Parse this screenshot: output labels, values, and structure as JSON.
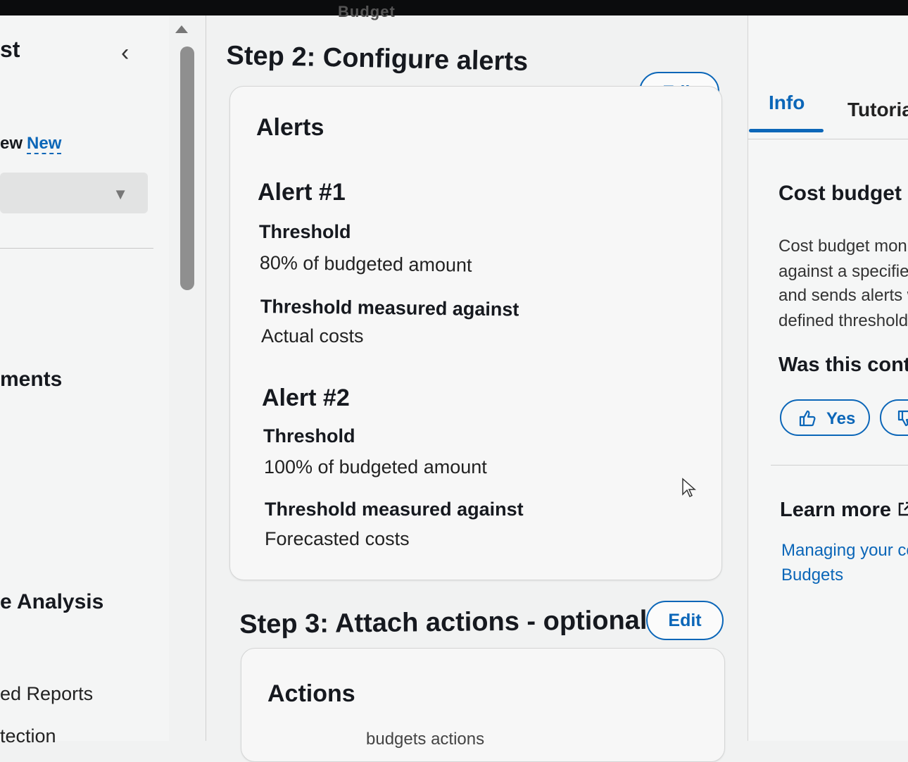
{
  "top": {
    "partial_title": "Budget"
  },
  "leftnav": {
    "title_fragment": "st",
    "new_row_prefix": "ew",
    "new_label": "New",
    "section_fragment": "ments",
    "analysis_fragment": "e Analysis",
    "reports_fragment": "ed Reports",
    "detection_fragment": "tection"
  },
  "main": {
    "step2": {
      "title": "Step 2: Configure alerts",
      "edit": "Edit",
      "card_title": "Alerts",
      "alerts": [
        {
          "title": "Alert #1",
          "threshold_label": "Threshold",
          "threshold_value": "80% of budgeted amount",
          "measured_label": "Threshold measured against",
          "measured_value": "Actual costs"
        },
        {
          "title": "Alert #2",
          "threshold_label": "Threshold",
          "threshold_value": "100% of budgeted amount",
          "measured_label": "Threshold measured against",
          "measured_value": "Forecasted costs"
        }
      ]
    },
    "step3": {
      "title": "Step 3: Attach actions - optional",
      "edit": "Edit",
      "card_title": "Actions",
      "partial_line": "budgets actions"
    }
  },
  "panel": {
    "tabs": [
      "Info",
      "Tutorial"
    ],
    "help_title": "Cost budget",
    "help_lines": [
      "Cost budget monit",
      "against a specified",
      "and sends alerts wh",
      "defined thresholds"
    ],
    "feedback_question": "Was this conte",
    "yes_label": "Yes",
    "learn_more": "Learn more",
    "links": [
      "Managing your cos",
      "Budgets"
    ]
  },
  "colors": {
    "accent": "#0b66b8",
    "text": "#16191f",
    "background": "#f1f2f2"
  },
  "icons": [
    "chevron-left-icon",
    "caret-down-icon",
    "thumbs-up-icon",
    "thumbs-down-icon",
    "external-link-icon",
    "mouse-cursor-icon"
  ]
}
